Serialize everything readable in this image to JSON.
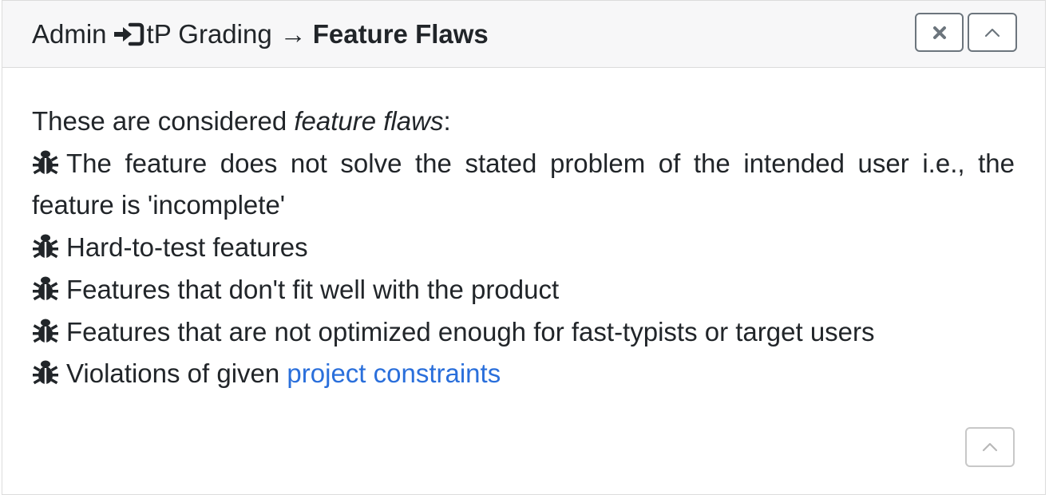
{
  "header": {
    "breadcrumb_root": "Admin",
    "breadcrumb_mid": "tP Grading",
    "breadcrumb_arrow": "→",
    "breadcrumb_current": "Feature Flaws",
    "close_icon": "close-x-icon",
    "collapse_icon": "chevron-up-icon"
  },
  "body": {
    "intro_prefix": "These are considered ",
    "intro_emphasis": "feature flaws",
    "intro_suffix": ":",
    "items": [
      "The feature does not solve the stated problem of the intended user i.e., the feature is 'incomplete'",
      "Hard-to-test features",
      "Features that don't fit well with the product",
      "Features that are not optimized enough for fast-typists or target users",
      "Violations of given "
    ],
    "last_item_link": "project constraints",
    "bullet_icon": "bug-icon"
  },
  "colors": {
    "link": "#2a6fdb",
    "header_bg": "#f7f7f8",
    "border": "#dcdcdc"
  }
}
